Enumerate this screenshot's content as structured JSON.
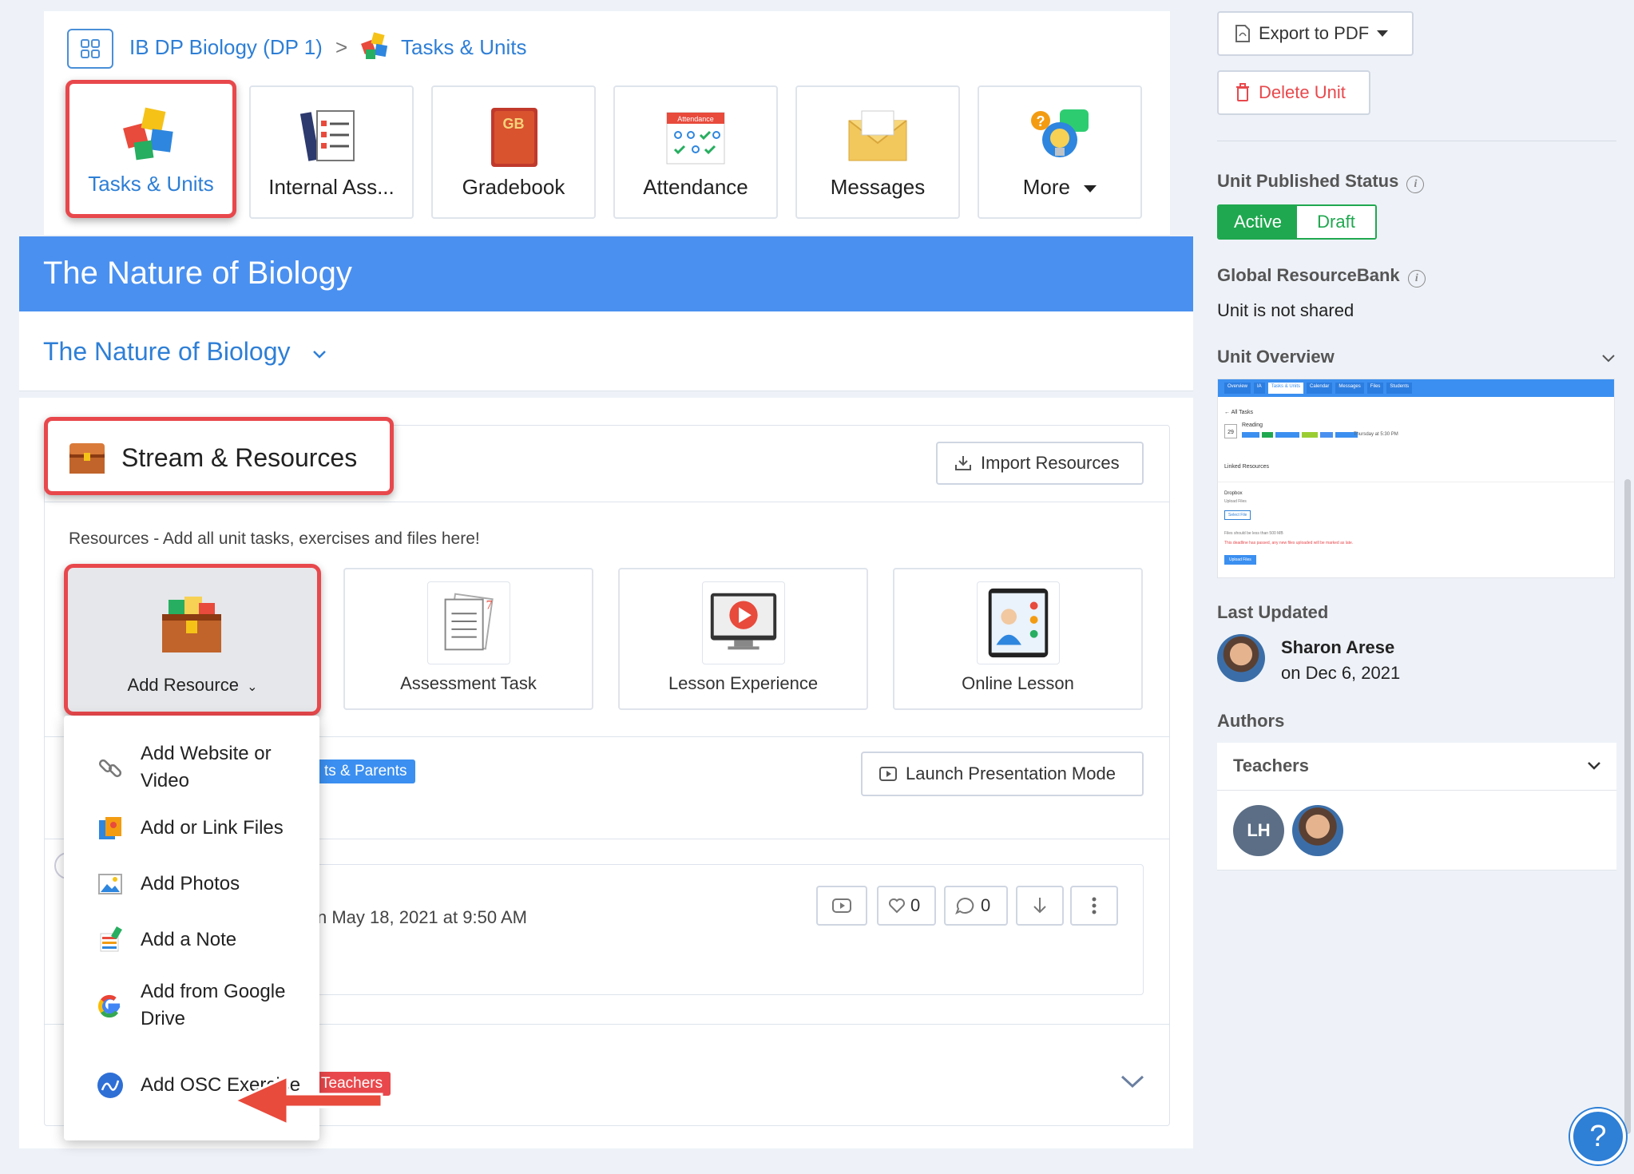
{
  "breadcrumb": {
    "course": "IB DP Biology (DP 1)",
    "separator": ">",
    "page": "Tasks & Units"
  },
  "nav_tiles": [
    {
      "label": "Tasks & Units",
      "icon": "puzzle-icon",
      "selected": true
    },
    {
      "label": "Internal Ass...",
      "icon": "checklist-icon"
    },
    {
      "label": "Gradebook",
      "icon": "gradebook-icon",
      "badge": "GB"
    },
    {
      "label": "Attendance",
      "icon": "attendance-calendar-icon",
      "badge": "Attendance"
    },
    {
      "label": "Messages",
      "icon": "envelope-icon"
    },
    {
      "label": "More",
      "icon": "lightbulb-chat-icon"
    }
  ],
  "unit": {
    "title": "The Nature of Biology",
    "selector_label": "The Nature of Biology"
  },
  "stream": {
    "title": "Stream & Resources",
    "import_label": "Import Resources",
    "resources_hint": "Resources - Add all unit tasks, exercises and files here!",
    "resource_tiles": [
      {
        "label": "Add Resource",
        "icon": "treasure-chest-icon"
      },
      {
        "label": "Assessment Task",
        "icon": "documents-icon"
      },
      {
        "label": "Lesson Experience",
        "icon": "video-monitor-icon"
      },
      {
        "label": "Online Lesson",
        "icon": "video-call-tablet-icon"
      }
    ],
    "audience_badge": "ts & Parents",
    "present_label": "Launch Presentation Mode",
    "post_date": "n May 18, 2021 at 9:50 AM",
    "likes": "0",
    "comments": "0",
    "teachers_badge": "Teachers"
  },
  "add_resource_menu": [
    {
      "label": "Add Website or Video",
      "icon": "link-icon"
    },
    {
      "label": "Add or Link Files",
      "icon": "files-icon"
    },
    {
      "label": "Add Photos",
      "icon": "photo-icon"
    },
    {
      "label": "Add a Note",
      "icon": "note-icon"
    },
    {
      "label": "Add from Google Drive",
      "icon": "google-icon"
    },
    {
      "label": "Add OSC Exercise",
      "icon": "osc-icon"
    }
  ],
  "sidebar": {
    "export_label": "Export to PDF",
    "delete_label": "Delete Unit",
    "published_label": "Unit Published Status",
    "status_active": "Active",
    "status_draft": "Draft",
    "resourcebank_label": "Global ResourceBank",
    "resourcebank_value": "Unit is not shared",
    "overview_label": "Unit Overview",
    "overview_thumb": {
      "tabs": [
        "Overview",
        "IA",
        "Tasks & Units",
        "Calendar",
        "Messages",
        "Files",
        "Students"
      ],
      "back_label": "All Tasks",
      "day": "29",
      "task_title": "Reading",
      "task_date": "Thursday at 5:30 PM",
      "linked": "Linked Resources",
      "dropbox": "Dropbox",
      "upload_files": "Upload Files",
      "select_file": "Select File",
      "size_note": "Files should be less than 500 MB",
      "deadline_note": "This deadline has passed, any new files uploaded will be marked as late.",
      "upload_button": "Upload Files"
    },
    "last_updated_label": "Last Updated",
    "updated_by": "Sharon Arese",
    "updated_on": "on Dec 6, 2021",
    "authors_label": "Authors",
    "teachers_label": "Teachers",
    "author_initials": "LH"
  },
  "help_label": "?",
  "colors": {
    "accent": "#2e7fd6",
    "highlight": "#e8484c",
    "active": "#1fa84f",
    "banner": "#4a90f0"
  }
}
